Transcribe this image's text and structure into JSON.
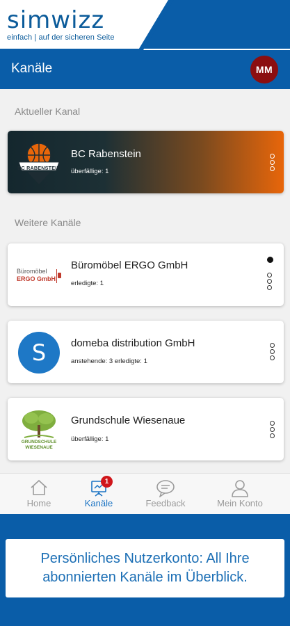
{
  "brand": {
    "logo_word_a": "sim",
    "logo_word_b": "wizz",
    "tagline": "einfach | auf der sicheren Seite"
  },
  "header": {
    "title": "Kanäle",
    "avatar_initials": "MM"
  },
  "sections": {
    "current_label": "Aktueller Kanal",
    "further_label": "Weitere Kanäle"
  },
  "current_channel": {
    "name": "BC Rabenstein",
    "status": "überfällige: 1",
    "logo_text": "BC RABENSTEIN"
  },
  "channels": [
    {
      "name": "Büromöbel ERGO GmbH",
      "status": "erledigte: 1",
      "logo_line1": "Büromöbel",
      "logo_line2": "ERGO GmbH",
      "unread": true
    },
    {
      "name": "domeba distribution GmbH",
      "status": "anstehende: 3 erledigte: 1",
      "logo_letter": "S"
    },
    {
      "name": "Grundschule Wiesenaue",
      "status": "überfällige: 1",
      "logo_line1": "GRUNDSCHULE",
      "logo_line2": "WIESENAUE"
    }
  ],
  "nav": {
    "home": "Home",
    "channels": "Kanäle",
    "feedback": "Feedback",
    "account": "Mein Konto",
    "channels_badge": "1"
  },
  "promo": {
    "text": "Persönliches Nutzerkonto: All Ihre abonnierten Kanäle im Überblick."
  },
  "colors": {
    "primary": "#0a5da8",
    "avatar": "#8b0e10",
    "badge": "#d0161b",
    "accent_orange": "#e8660a"
  }
}
